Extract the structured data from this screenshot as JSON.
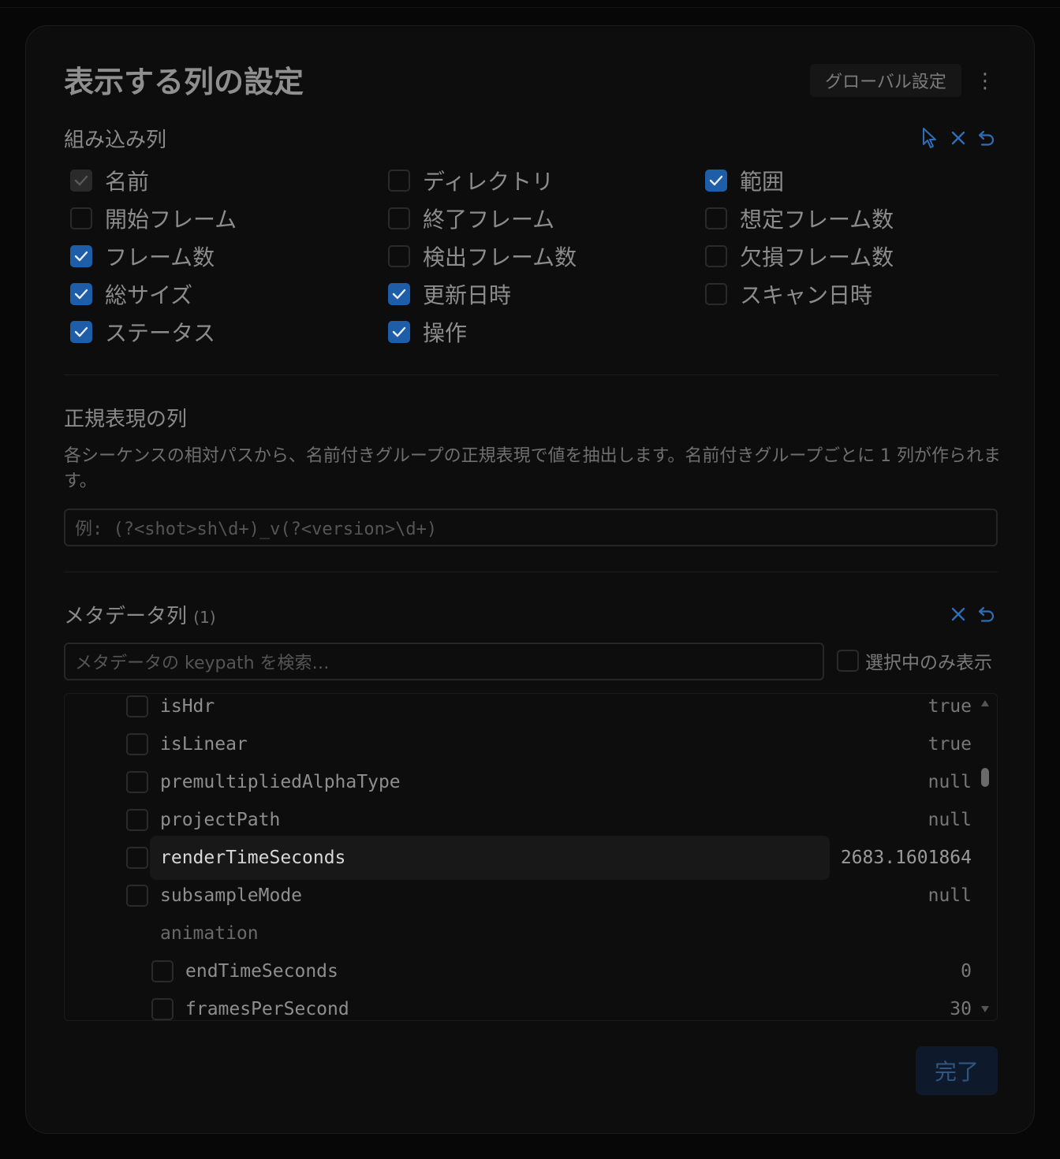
{
  "modal": {
    "title": "表示する列の設定",
    "global_settings_label": "グローバル設定",
    "more_label": "⋮"
  },
  "builtin": {
    "title": "組み込み列",
    "columns": [
      {
        "label": "名前",
        "state": "disabled"
      },
      {
        "label": "ディレクトリ",
        "state": "unchecked"
      },
      {
        "label": "範囲",
        "state": "checked"
      },
      {
        "label": "開始フレーム",
        "state": "unchecked"
      },
      {
        "label": "終了フレーム",
        "state": "unchecked"
      },
      {
        "label": "想定フレーム数",
        "state": "unchecked"
      },
      {
        "label": "フレーム数",
        "state": "checked"
      },
      {
        "label": "検出フレーム数",
        "state": "unchecked"
      },
      {
        "label": "欠損フレーム数",
        "state": "unchecked"
      },
      {
        "label": "総サイズ",
        "state": "checked"
      },
      {
        "label": "更新日時",
        "state": "checked"
      },
      {
        "label": "スキャン日時",
        "state": "unchecked"
      },
      {
        "label": "ステータス",
        "state": "checked"
      },
      {
        "label": "操作",
        "state": "checked"
      }
    ]
  },
  "regex": {
    "title": "正規表現の列",
    "description": "各シーケンスの相対パスから、名前付きグループの正規表現で値を抽出します。名前付きグループごとに 1 列が作られます。",
    "placeholder": "例: (?<shot>sh\\d+)_v(?<version>\\d+)"
  },
  "metadata": {
    "title": "メタデータ列",
    "count": "(1)",
    "search_placeholder": "メタデータの keypath を検索…",
    "selected_only_label": "選択中のみ表示",
    "rows": [
      {
        "key": "isHdr",
        "value": "true",
        "indent": 0,
        "type": "item"
      },
      {
        "key": "isLinear",
        "value": "true",
        "indent": 0,
        "type": "item"
      },
      {
        "key": "premultipliedAlphaType",
        "value": "null",
        "indent": 0,
        "type": "item"
      },
      {
        "key": "projectPath",
        "value": "null",
        "indent": 0,
        "type": "item"
      },
      {
        "key": "renderTimeSeconds",
        "value": "2683.1601864",
        "indent": 0,
        "type": "item",
        "highlight": true
      },
      {
        "key": "subsampleMode",
        "value": "null",
        "indent": 0,
        "type": "item"
      },
      {
        "key": "animation",
        "value": "",
        "indent": 0,
        "type": "group"
      },
      {
        "key": "endTimeSeconds",
        "value": "0",
        "indent": 1,
        "type": "item"
      },
      {
        "key": "framesPerSecond",
        "value": "30",
        "indent": 1,
        "type": "item"
      }
    ]
  },
  "done_label": "完了",
  "colors": {
    "accent": "#1e5ea8",
    "background": "#0d0d0d"
  }
}
